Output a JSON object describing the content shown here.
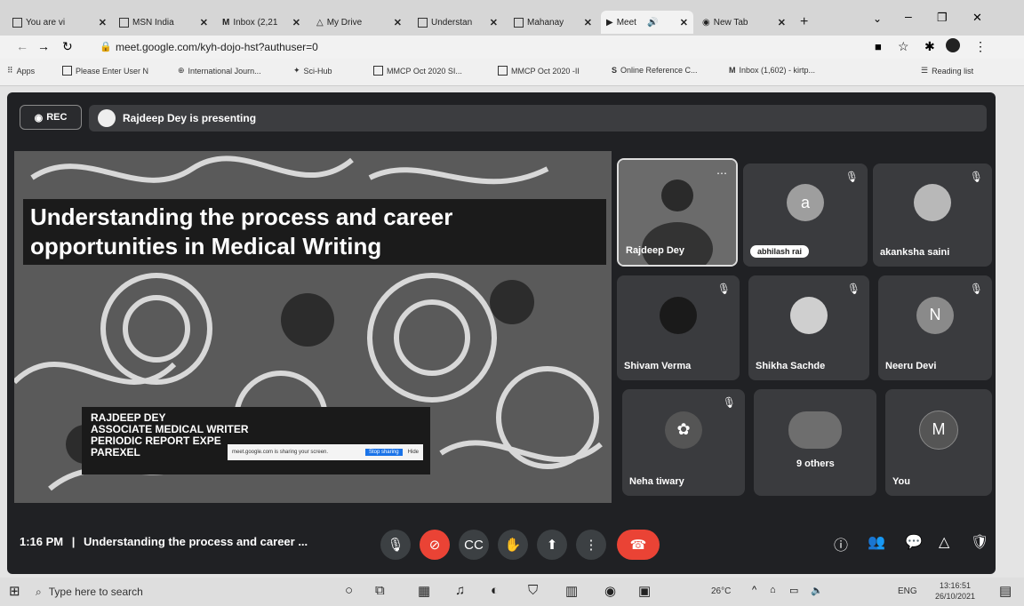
{
  "browser": {
    "tabs": [
      {
        "title": "You are vi",
        "active": false
      },
      {
        "title": "MSN India",
        "active": false
      },
      {
        "title": "Inbox (2,21",
        "active": false
      },
      {
        "title": "My Drive",
        "active": false
      },
      {
        "title": "Understan",
        "active": false
      },
      {
        "title": "Mahanay",
        "active": false
      },
      {
        "title": "Meet",
        "active": true
      },
      {
        "title": "New Tab",
        "active": false
      }
    ],
    "new_tab_label": "+",
    "url": "meet.google.com/kyh-dojo-hst?authuser=0",
    "bookmarks": [
      "Apps",
      "Please Enter User N",
      "International Journ...",
      "Sci-Hub",
      "MMCP Oct 2020 SI...",
      "MMCP Oct 2020 -II",
      "Online Reference C...",
      "Inbox (1,602) - kirtp..."
    ],
    "reading_list": "Reading list"
  },
  "meet": {
    "rec_label": "REC",
    "presenting_text": "Rajdeep Dey is presenting",
    "slide": {
      "title_line1": "Understanding the process and career",
      "title_line2": "opportunities in Medical Writing",
      "presenter_lines": [
        "RAJDEEP DEY",
        "ASSOCIATE MEDICAL WRITER",
        "PERIODIC REPORT EXPE",
        "PAREXEL"
      ],
      "share_banner_text": "meet.google.com is sharing your screen.",
      "stop_sharing_label": "Stop sharing",
      "hide_label": "Hide"
    },
    "participants": [
      {
        "name": "Rajdeep Dey",
        "initial": "",
        "muted": false,
        "avatar_color": "#6b6b6b"
      },
      {
        "name": "abhilash rai",
        "initial": "a",
        "muted": true,
        "avatar_color": "#9e9e9e"
      },
      {
        "name": "akanksha saini",
        "initial": "",
        "muted": true,
        "avatar_color": "#b8b8b8"
      },
      {
        "name": "Shivam Verma",
        "initial": "",
        "muted": true,
        "avatar_color": "#1a1a1a"
      },
      {
        "name": "Shikha Sachde",
        "initial": "",
        "muted": true,
        "avatar_color": "#cfcfcf"
      },
      {
        "name": "Neeru Devi",
        "initial": "N",
        "muted": true,
        "avatar_color": "#8a8a8a"
      },
      {
        "name": "Neha tiwary",
        "initial": "",
        "muted": true,
        "avatar_color": "#555555"
      },
      {
        "name": "9 others",
        "initial": "",
        "muted": false,
        "avatar_color": "#6e6e6e"
      },
      {
        "name": "You",
        "initial": "M",
        "muted": false,
        "avatar_color": "#555555"
      }
    ],
    "clock": "1:16 PM",
    "meeting_title": "Understanding the process and career ..."
  },
  "taskbar": {
    "search_placeholder": "Type here to search",
    "temperature": "26°C",
    "language": "ENG",
    "time": "13:16:51",
    "date": "26/10/2021"
  }
}
